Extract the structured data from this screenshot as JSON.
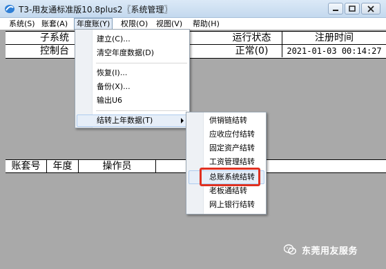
{
  "window": {
    "title": "T3-用友通标准版10.8plus2〖系统管理〗"
  },
  "menubar": {
    "items": [
      "系统(S)",
      "账套(A)",
      "年度账(Y)",
      "权限(O)",
      "视图(V)",
      "帮助(H)"
    ]
  },
  "top_grid": {
    "columns": [
      "子系统",
      "运行状态",
      "注册时间"
    ],
    "rows": [
      {
        "subsystem": "控制台",
        "status": "正常(0)",
        "time": "2021-01-03 00:14:27"
      }
    ]
  },
  "bottom_grid": {
    "columns": [
      "账套号",
      "年度",
      "操作员"
    ]
  },
  "year_menu": {
    "items": [
      "建立(C)...",
      "清空年度数据(D)",
      "恢复(I)...",
      "备份(X)...",
      "输出U6",
      "结转上年数据(T)"
    ]
  },
  "carryover_submenu": {
    "items": [
      "供销链结转",
      "应收应付结转",
      "固定资产结转",
      "工资管理结转",
      "总账系统结转",
      "老板通结转",
      "网上银行结转"
    ],
    "selected": "总账系统结转"
  },
  "watermark": {
    "text": "东莞用友服务",
    "icon": "wechat-icon"
  },
  "colors": {
    "client_background": "#a9a9a9",
    "title_background": "#c9dff3",
    "highlight": "#e03020"
  }
}
